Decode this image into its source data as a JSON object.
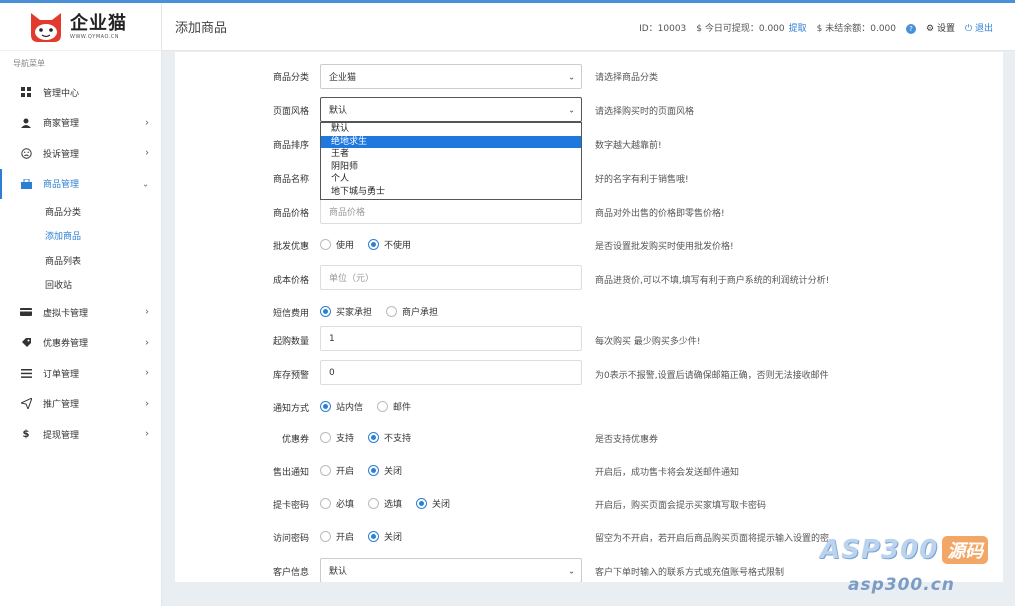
{
  "app": {
    "logo_name": "企业猫",
    "logo_url": "WWW.QYMAO.CN"
  },
  "header": {
    "title": "添加商品",
    "id_text": "ID：10003",
    "withdraw_label": "$ 今日可提现：0.000",
    "withdraw_link": "提取",
    "unsettled_label": "$ 未结余额：0.000",
    "settings_label": "设置",
    "logout_label": "退出"
  },
  "sidebar": {
    "menu_title": "导航菜单",
    "items": [
      {
        "label": "管理中心",
        "icon": "dashboard-icon"
      },
      {
        "label": "商家管理",
        "icon": "user-icon"
      },
      {
        "label": "投诉管理",
        "icon": "face-icon"
      },
      {
        "label": "商品管理",
        "icon": "shop-icon"
      },
      {
        "label": "虚拟卡管理",
        "icon": "card-icon"
      },
      {
        "label": "优惠券管理",
        "icon": "tag-icon"
      },
      {
        "label": "订单管理",
        "icon": "list-icon"
      },
      {
        "label": "推广管理",
        "icon": "send-icon"
      },
      {
        "label": "提现管理",
        "icon": "dollar-icon"
      }
    ],
    "sub_items": [
      "商品分类",
      "添加商品",
      "商品列表",
      "回收站"
    ]
  },
  "form": {
    "category": {
      "label": "商品分类",
      "value": "企业猫",
      "help": "请选择商品分类"
    },
    "style": {
      "label": "页面风格",
      "value": "默认",
      "help": "请选择购买时的页面风格",
      "options": [
        "默认",
        "绝地求生",
        "王者",
        "阴阳师",
        "个人",
        "地下城与勇士"
      ]
    },
    "sort": {
      "label": "商品排序",
      "help": "数字越大越靠前!"
    },
    "name": {
      "label": "商品名称",
      "help": "好的名字有利于销售哦!"
    },
    "price": {
      "label": "商品价格",
      "placeholder": "商品价格",
      "help": "商品对外出售的价格即零售价格!"
    },
    "wholesale": {
      "label": "批发优惠",
      "opt1": "使用",
      "opt2": "不使用",
      "help": "是否设置批发购买时使用批发价格!"
    },
    "cost": {
      "label": "成本价格",
      "placeholder": "单位（元）",
      "help": "商品进货价,可以不填,填写有利于商户系统的利润统计分析!"
    },
    "sms": {
      "label": "短信费用",
      "opt1": "买家承担",
      "opt2": "商户承担"
    },
    "min_qty": {
      "label": "起购数量",
      "value": "1",
      "help": "每次购买 最少购买多少件!"
    },
    "stock_alert": {
      "label": "库存预警",
      "value": "0",
      "help": "为0表示不报警,设置后请确保邮箱正确，否则无法接收邮件"
    },
    "notify": {
      "label": "通知方式",
      "opt1": "站内信",
      "opt2": "邮件"
    },
    "coupon": {
      "label": "优惠券",
      "opt1": "支持",
      "opt2": "不支持",
      "help": "是否支持优惠券"
    },
    "sale_notify": {
      "label": "售出通知",
      "opt1": "开启",
      "opt2": "关闭",
      "help": "开启后，成功售卡将会发送邮件通知"
    },
    "card_pwd": {
      "label": "提卡密码",
      "opt1": "必填",
      "opt2": "选填",
      "opt3": "关闭",
      "help": "开启后，购买页面会提示买家填写取卡密码"
    },
    "access_pwd": {
      "label": "访问密码",
      "opt1": "开启",
      "opt2": "关闭",
      "help": "留空为不开启，若开启后商品购买页面将提示输入设置的密"
    },
    "customer_info": {
      "label": "客户信息",
      "value": "默认",
      "help": "客户下单时输入的联系方式或充值账号格式限制"
    }
  },
  "watermark": {
    "brand": "ASP300",
    "badge": "源码",
    "url": "asp300.cn"
  },
  "colors": {
    "accent": "#2d7fd3",
    "highlight": "#1e78e0"
  }
}
